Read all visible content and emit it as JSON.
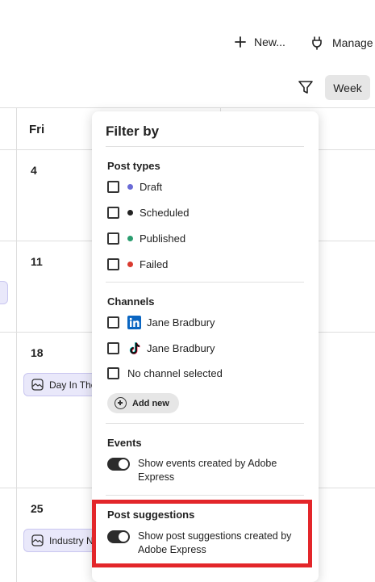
{
  "toolbar": {
    "new_label": "New...",
    "manage_label": "Manage c",
    "week_label": "Week"
  },
  "calendar": {
    "day_header": "Fri",
    "days": [
      "4",
      "11",
      "18",
      "25"
    ],
    "events": {
      "day18": "Day In The",
      "day25": "Industry N"
    }
  },
  "filter": {
    "title": "Filter by",
    "post_types_title": "Post types",
    "post_types": [
      {
        "label": "Draft",
        "color": "#6a6bd6"
      },
      {
        "label": "Scheduled",
        "color": "#222222"
      },
      {
        "label": "Published",
        "color": "#2a9d6f"
      },
      {
        "label": "Failed",
        "color": "#d93a2f"
      }
    ],
    "channels_title": "Channels",
    "channels": [
      {
        "label": "Jane Bradbury",
        "icon": "linkedin-icon"
      },
      {
        "label": "Jane Bradbury",
        "icon": "tiktok-icon"
      },
      {
        "label": "No channel selected"
      }
    ],
    "add_new_label": "Add new",
    "events_title": "Events",
    "events_toggle_label": "Show events created by Adobe Express",
    "suggestions_title": "Post suggestions",
    "suggestions_toggle_label": "Show post suggestions created by Adobe Express"
  },
  "colors": {
    "highlight": "#e3262a",
    "event_chip_bg": "#e9e8fa",
    "linkedin": "#0a66c2"
  }
}
